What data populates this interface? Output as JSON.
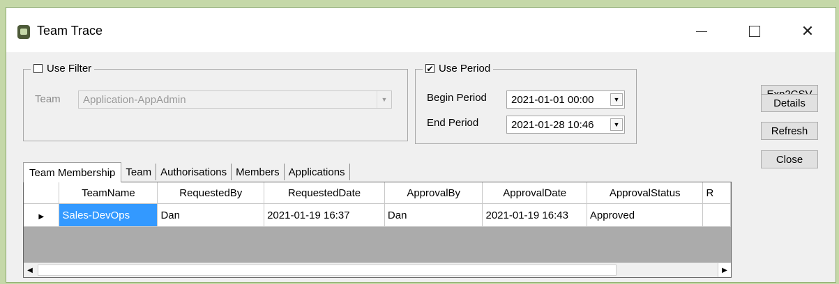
{
  "window": {
    "title": "Team Trace",
    "icons": {
      "app": "app-icon",
      "minimize": "minimize-icon",
      "maximize": "maximize-icon",
      "close": "close-icon"
    },
    "close_glyph": "✕"
  },
  "filter": {
    "checkbox_label": "Use Filter",
    "checked": false,
    "team_label": "Team",
    "team_value": "Application-AppAdmin"
  },
  "period": {
    "checkbox_label": "Use Period",
    "checked": true,
    "check_glyph": "✔",
    "begin_label": "Begin Period",
    "begin_value": "2021-01-01 00:00",
    "end_label": "End Period",
    "end_value": "2021-01-28 10:46"
  },
  "buttons": {
    "exp2csv": "Exp2CSV",
    "details": "Details",
    "refresh": "Refresh",
    "close": "Close"
  },
  "tabs": [
    "Team Membership",
    "Team",
    "Authorisations",
    "Members",
    "Applications"
  ],
  "active_tab": "Team Membership",
  "grid": {
    "columns": [
      "TeamName",
      "RequestedBy",
      "RequestedDate",
      "ApprovalBy",
      "ApprovalDate",
      "ApprovalStatus",
      "R"
    ],
    "rows": [
      {
        "TeamName": "Sales-DevOps",
        "RequestedBy": "Dan",
        "RequestedDate": "2021-01-19 16:37",
        "ApprovalBy": "Dan",
        "ApprovalDate": "2021-01-19 16:43",
        "ApprovalStatus": "Approved",
        "R": ""
      }
    ],
    "row_indicator": "▶"
  },
  "colors": {
    "selection": "#3399ff",
    "window_bg": "#f0f0f0",
    "desktop": "#c5d8a8"
  }
}
